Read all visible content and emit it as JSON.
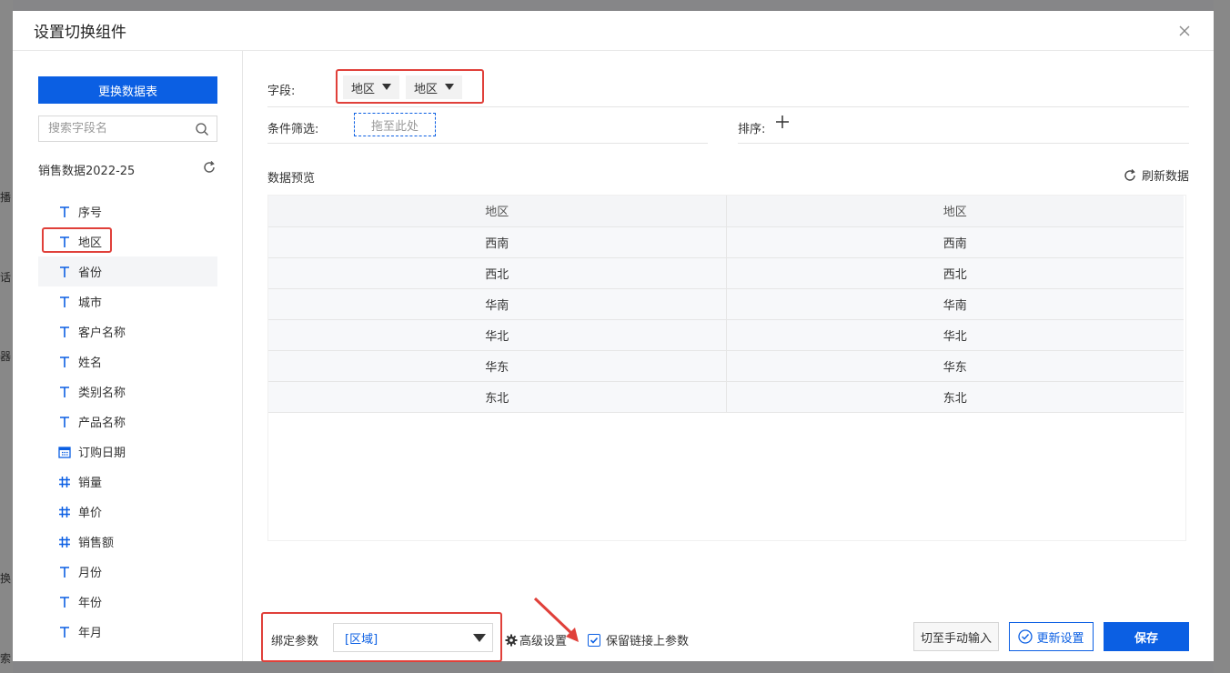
{
  "dialog": {
    "title": "设置切换组件"
  },
  "left": {
    "change_table_label": "更换数据表",
    "search_placeholder": "搜索字段名",
    "dataset_name": "销售数据2022-25",
    "fields": [
      {
        "label": "序号",
        "type": "text"
      },
      {
        "label": "地区",
        "type": "text"
      },
      {
        "label": "省份",
        "type": "text"
      },
      {
        "label": "城市",
        "type": "text"
      },
      {
        "label": "客户名称",
        "type": "text"
      },
      {
        "label": "姓名",
        "type": "text"
      },
      {
        "label": "类别名称",
        "type": "text"
      },
      {
        "label": "产品名称",
        "type": "text"
      },
      {
        "label": "订购日期",
        "type": "date"
      },
      {
        "label": "销量",
        "type": "number"
      },
      {
        "label": "单价",
        "type": "number"
      },
      {
        "label": "销售额",
        "type": "number"
      },
      {
        "label": "月份",
        "type": "text"
      },
      {
        "label": "年份",
        "type": "text"
      },
      {
        "label": "年月",
        "type": "text"
      }
    ]
  },
  "config": {
    "fields_label": "字段:",
    "chips": [
      "地区",
      "地区"
    ],
    "filter_label": "条件筛选:",
    "drop_placeholder": "拖至此处",
    "sort_label": "排序:",
    "preview_label": "数据预览",
    "refresh_label": "刷新数据"
  },
  "preview": {
    "headers": [
      "地区",
      "地区"
    ],
    "rows": [
      [
        "西南",
        "西南"
      ],
      [
        "西北",
        "西北"
      ],
      [
        "华南",
        "华南"
      ],
      [
        "华北",
        "华北"
      ],
      [
        "华东",
        "华东"
      ],
      [
        "东北",
        "东北"
      ]
    ]
  },
  "bottom": {
    "bind_label": "绑定参数",
    "bind_value": "[区域]",
    "advanced_label": "高级设置",
    "keep_param_label": "保留链接上参数",
    "keep_param_checked": true,
    "manual_label": "切至手动输入",
    "update_label": "更新设置",
    "save_label": "保存"
  },
  "background": {
    "left_chars": [
      "播",
      "话",
      "器",
      "换",
      "索"
    ]
  },
  "colors": {
    "accent": "#0b5fe3",
    "annotation": "#e0403a"
  }
}
